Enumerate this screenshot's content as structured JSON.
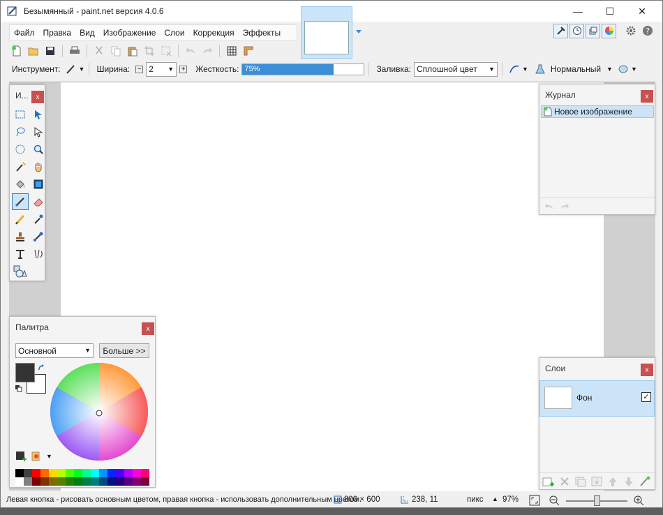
{
  "window": {
    "title": "Безымянный - paint.net версия 4.0.6",
    "minimize": "—",
    "maximize": "☐",
    "close": "✕"
  },
  "menu": [
    "Файл",
    "Правка",
    "Вид",
    "Изображение",
    "Слои",
    "Коррекция",
    "Эффекты"
  ],
  "toolbar2": {
    "tool_label": "Инструмент:",
    "width_label": "Ширина:",
    "width_value": "2",
    "hardness_label": "Жесткость:",
    "hardness_value": "75%",
    "hardness_fraction": 0.75,
    "fill_label": "Заливка:",
    "fill_value": "Сплошной цвет",
    "blend_value": "Нормальный"
  },
  "tools_panel": {
    "title": "И...",
    "close": "x"
  },
  "history_panel": {
    "title": "Журнал",
    "close": "x",
    "items": [
      "Новое изображение"
    ]
  },
  "palette_panel": {
    "title": "Палитра",
    "close": "x",
    "mode": "Основной",
    "more_button": "Больше >>",
    "primary_color": "#333333",
    "secondary_color": "#ffffff",
    "swatches": [
      "#000000",
      "#404040",
      "#ff0000",
      "#ff6a00",
      "#ffd800",
      "#b6ff00",
      "#4cff00",
      "#00ff21",
      "#00ff90",
      "#00ffff",
      "#0094ff",
      "#0026ff",
      "#4800ff",
      "#b200ff",
      "#ff00dc",
      "#ff006e",
      "#ffffff",
      "#808080",
      "#7f0000",
      "#7f3300",
      "#7f6a00",
      "#5b7f00",
      "#267f00",
      "#007f0e",
      "#007f46",
      "#007f7f",
      "#004a7f",
      "#00137f",
      "#21007f",
      "#57007f",
      "#7f006e",
      "#7f0037"
    ]
  },
  "layers_panel": {
    "title": "Слои",
    "close": "x",
    "layers": [
      {
        "name": "Фон",
        "visible": "✓"
      }
    ]
  },
  "status": {
    "hint": "Левая кнопка - рисовать основным цветом, правая кнопка - использовать дополнительным цветом.",
    "size": "800 × 600",
    "cursor": "238, 11",
    "units": "пикс",
    "zoom": "97%"
  },
  "colors": {
    "accent": "#3b8fd8",
    "selection": "#cce4f7",
    "close_red": "#c75050"
  }
}
